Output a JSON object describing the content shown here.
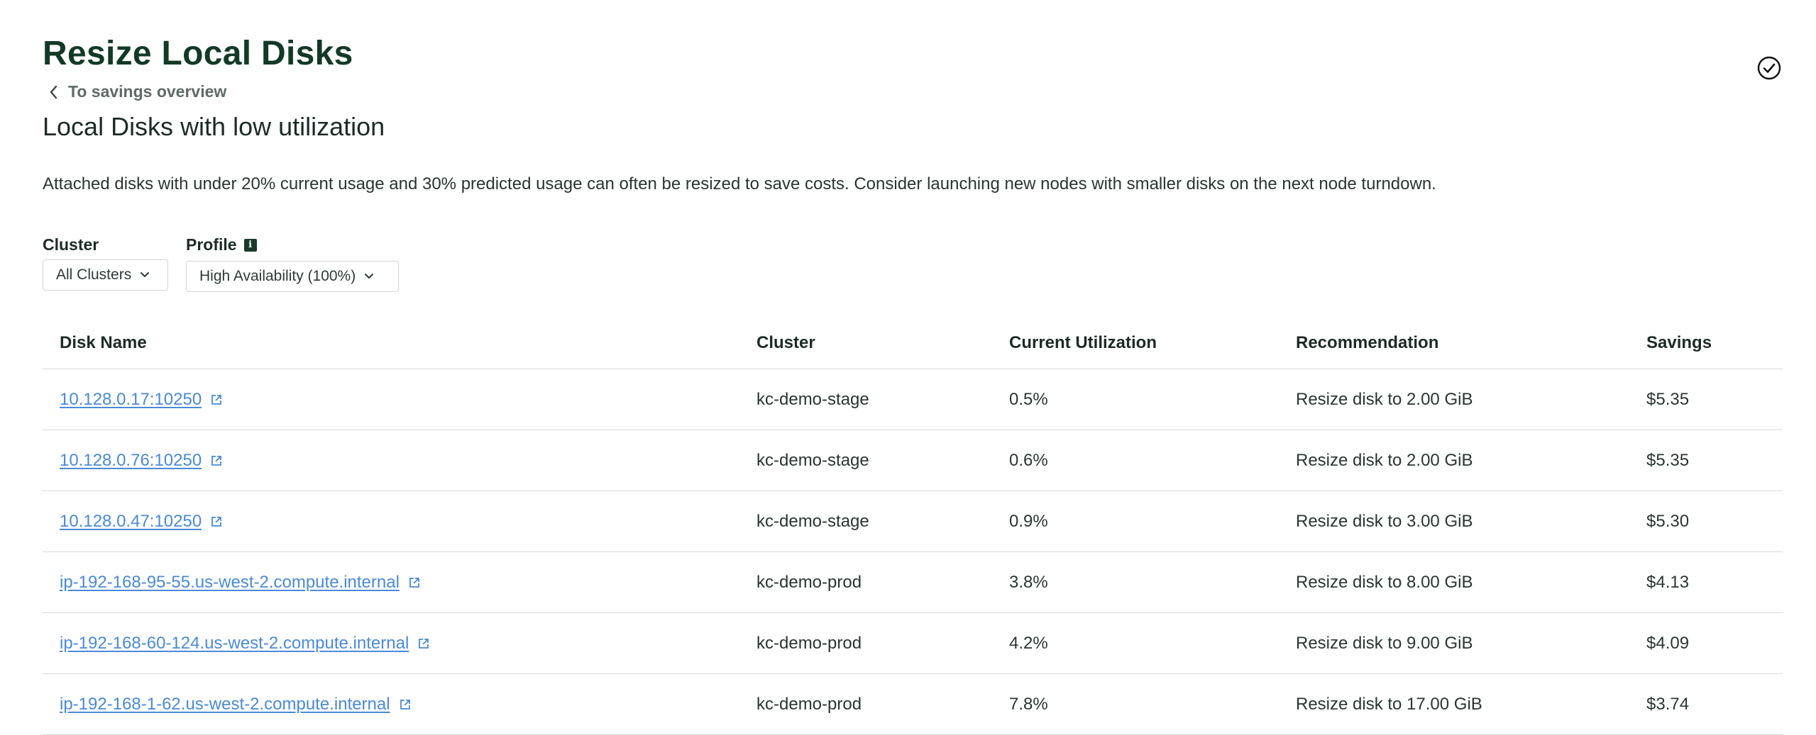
{
  "header": {
    "title": "Resize Local Disks",
    "back_label": "To savings overview"
  },
  "section": {
    "subtitle": "Local Disks with low utilization",
    "description": "Attached disks with under 20% current usage and 30% predicted usage can often be resized to save costs. Consider launching new nodes with smaller disks on the next node turndown."
  },
  "filters": {
    "cluster_label": "Cluster",
    "cluster_value": "All Clusters",
    "profile_label": "Profile",
    "profile_info": "i",
    "profile_value": "High Availability (100%)"
  },
  "table": {
    "columns": [
      "Disk Name",
      "Cluster",
      "Current Utilization",
      "Recommendation",
      "Savings"
    ],
    "rows": [
      {
        "name": "10.128.0.17:10250",
        "cluster": "kc-demo-stage",
        "utilization": "0.5%",
        "recommendation": "Resize disk to 2.00 GiB",
        "savings": "$5.35"
      },
      {
        "name": "10.128.0.76:10250",
        "cluster": "kc-demo-stage",
        "utilization": "0.6%",
        "recommendation": "Resize disk to 2.00 GiB",
        "savings": "$5.35"
      },
      {
        "name": "10.128.0.47:10250",
        "cluster": "kc-demo-stage",
        "utilization": "0.9%",
        "recommendation": "Resize disk to 3.00 GiB",
        "savings": "$5.30"
      },
      {
        "name": "ip-192-168-95-55.us-west-2.compute.internal",
        "cluster": "kc-demo-prod",
        "utilization": "3.8%",
        "recommendation": "Resize disk to 8.00 GiB",
        "savings": "$4.13"
      },
      {
        "name": "ip-192-168-60-124.us-west-2.compute.internal",
        "cluster": "kc-demo-prod",
        "utilization": "4.2%",
        "recommendation": "Resize disk to 9.00 GiB",
        "savings": "$4.09"
      },
      {
        "name": "ip-192-168-1-62.us-west-2.compute.internal",
        "cluster": "kc-demo-prod",
        "utilization": "7.8%",
        "recommendation": "Resize disk to 17.00 GiB",
        "savings": "$3.74"
      }
    ]
  },
  "icons": {
    "back": "chevron-left-icon",
    "check": "check-circle-icon",
    "info": "info-icon",
    "dropdown": "chevron-down-icon",
    "external": "external-link-icon"
  },
  "colors": {
    "title": "#123a26",
    "link": "#4a8ad8",
    "divider": "#d5dbd8"
  }
}
